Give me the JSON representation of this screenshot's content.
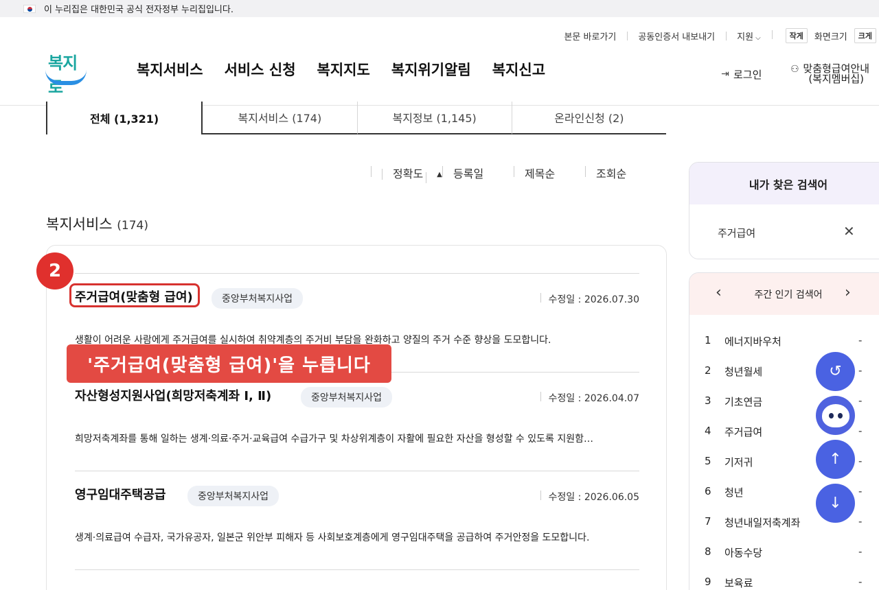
{
  "gov_banner": "이 누리집은 대한민국 공식 전자정부 누리집입니다.",
  "utility": {
    "skip": "본문 바로가기",
    "cert": "공동인증서 내보내기",
    "support": "지원",
    "small": "작게",
    "screen_size": "화면크기",
    "large": "크게"
  },
  "logo_text": "복지로",
  "gnb": [
    "복지서비스",
    "서비스 신청",
    "복지지도",
    "복지위기알림",
    "복지신고"
  ],
  "header": {
    "login": "로그인",
    "member_line1": "맞춤형급여안내",
    "member_line2": "(복지멤버십)"
  },
  "tabs": [
    "전체  (1,321)",
    "복지서비스 (174)",
    "복지정보 (1,145)",
    "온라인신청 (2)"
  ],
  "sort": [
    "정확도",
    "등록일",
    "제목순",
    "조회순"
  ],
  "section": {
    "title": "복지서비스",
    "count": "(174)"
  },
  "results": [
    {
      "title": "주거급여(맞춤형 급여)",
      "tag": "중앙부처복지사업",
      "date": "수정일 : 2026.07.30",
      "desc": "생활이 어려운 사람에게 주거급여를 실시하여 취약계층의 주거비 부담을 완화하고 양질의 주거 수준 향상을 도모합니다."
    },
    {
      "title": "자산형성지원사업(희망저축계좌 Ⅰ, Ⅱ)",
      "tag": "중앙부처복지사업",
      "date": "수정일 : 2026.04.07",
      "desc": "희망저축계좌를 통해 일하는 생계·의료·주거·교육급여 수급가구 및 차상위계층이 자활에 필요한 자산을 형성할 수 있도록 지원함…"
    },
    {
      "title": "영구임대주택공급",
      "tag": "중앙부처복지사업",
      "date": "수정일 : 2026.06.05",
      "desc": "생계·의료급여 수급자, 국가유공자, 일본군 위안부 피해자 등 사회보호계층에게 영구임대주택을 공급하여 주거안정을 도모합니다."
    }
  ],
  "annotation": {
    "step": "2",
    "callout": "'주거급여(맞춤형 급여)'을 누릅니다"
  },
  "my_search": {
    "title": "내가 찾은 검색어",
    "keyword": "주거급여"
  },
  "popular": {
    "title": "주간 인기 검색어",
    "items": [
      {
        "rank": "1",
        "word": "에너지바우처"
      },
      {
        "rank": "2",
        "word": "청년월세"
      },
      {
        "rank": "3",
        "word": "기초연금"
      },
      {
        "rank": "4",
        "word": "주거급여"
      },
      {
        "rank": "5",
        "word": "기저귀"
      },
      {
        "rank": "6",
        "word": "청년"
      },
      {
        "rank": "7",
        "word": "청년내일저축계좌"
      },
      {
        "rank": "8",
        "word": "아동수당"
      },
      {
        "rank": "9",
        "word": "보육료"
      }
    ],
    "dash": "-"
  },
  "colors": {
    "accent": "#e0302d",
    "fab": "#4a62e2"
  }
}
